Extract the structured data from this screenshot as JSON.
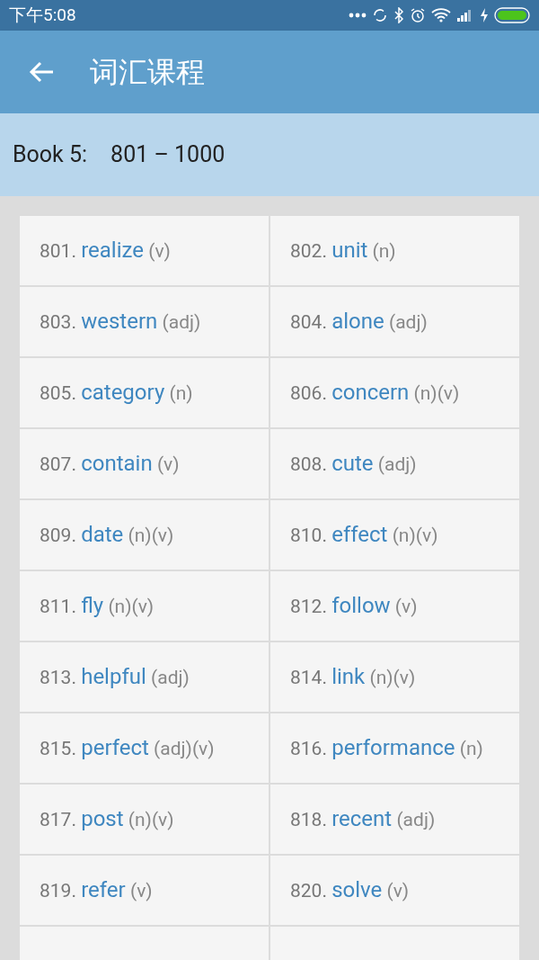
{
  "status_bar": {
    "time": "下午5:08"
  },
  "app_bar": {
    "title": "词汇课程"
  },
  "subheader": {
    "book": "Book 5:",
    "range": "801 – 1000"
  },
  "words": [
    {
      "number": "801.",
      "word": "realize",
      "pos": "(v)"
    },
    {
      "number": "802.",
      "word": "unit",
      "pos": "(n)"
    },
    {
      "number": "803.",
      "word": "western",
      "pos": "(adj)"
    },
    {
      "number": "804.",
      "word": "alone",
      "pos": "(adj)"
    },
    {
      "number": "805.",
      "word": "category",
      "pos": "(n)"
    },
    {
      "number": "806.",
      "word": "concern",
      "pos": "(n)(v)"
    },
    {
      "number": "807.",
      "word": "contain",
      "pos": "(v)"
    },
    {
      "number": "808.",
      "word": "cute",
      "pos": "(adj)"
    },
    {
      "number": "809.",
      "word": "date",
      "pos": "(n)(v)"
    },
    {
      "number": "810.",
      "word": "effect",
      "pos": "(n)(v)"
    },
    {
      "number": "811.",
      "word": "fly",
      "pos": "(n)(v)"
    },
    {
      "number": "812.",
      "word": "follow",
      "pos": "(v)"
    },
    {
      "number": "813.",
      "word": "helpful",
      "pos": "(adj)"
    },
    {
      "number": "814.",
      "word": "link",
      "pos": "(n)(v)"
    },
    {
      "number": "815.",
      "word": "perfect",
      "pos": "(adj)(v)"
    },
    {
      "number": "816.",
      "word": "performance",
      "pos": "(n)"
    },
    {
      "number": "817.",
      "word": "post",
      "pos": "(n)(v)"
    },
    {
      "number": "818.",
      "word": "recent",
      "pos": "(adj)"
    },
    {
      "number": "819.",
      "word": "refer",
      "pos": "(v)"
    },
    {
      "number": "820.",
      "word": "solve",
      "pos": "(v)"
    }
  ]
}
